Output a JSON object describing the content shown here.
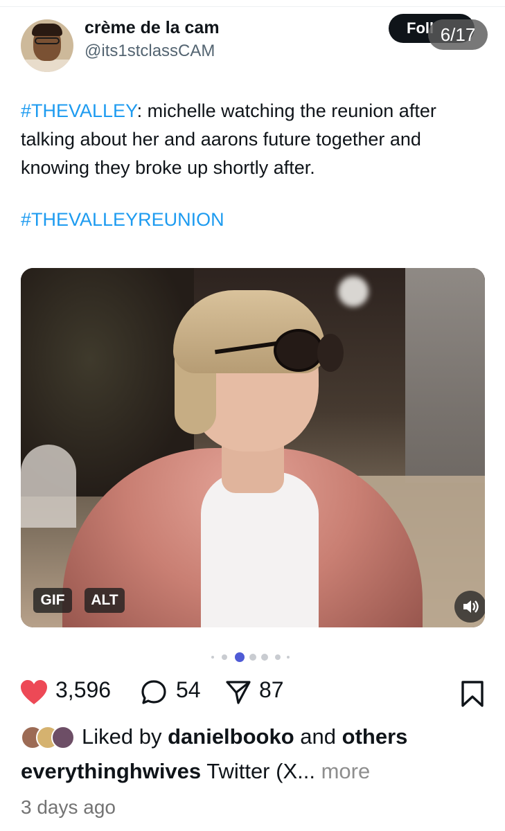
{
  "tweet": {
    "author_name": "crème de la cam",
    "author_handle": "@its1stclassCAM",
    "follow_label": "Foll",
    "text_hashtag": "#THEVALLEY",
    "text_body": ": michelle watching the reunion after talking about her and aarons future together and knowing they broke up shortly after.",
    "hashtag_2": "#THEVALLEYREUNION",
    "media": {
      "gif_label": "GIF",
      "alt_label": "ALT"
    }
  },
  "carousel": {
    "counter": "6/17",
    "active_dot_index": 2,
    "dot_count": 7
  },
  "post": {
    "like_count": "3,596",
    "reply_count": "54",
    "share_count": "87",
    "liked_by_prefix": "Liked by",
    "liked_by_user": "danielbooko",
    "liked_by_conj": "and",
    "liked_by_others": "others",
    "caption_user": "everythinghwives",
    "caption_text": "Twitter (X...",
    "more_label": "more",
    "time_ago": "3 days ago"
  },
  "colors": {
    "heart": "#ed4956",
    "hashtag": "#1d9bf0",
    "active_dot": "#4f5bd5"
  }
}
